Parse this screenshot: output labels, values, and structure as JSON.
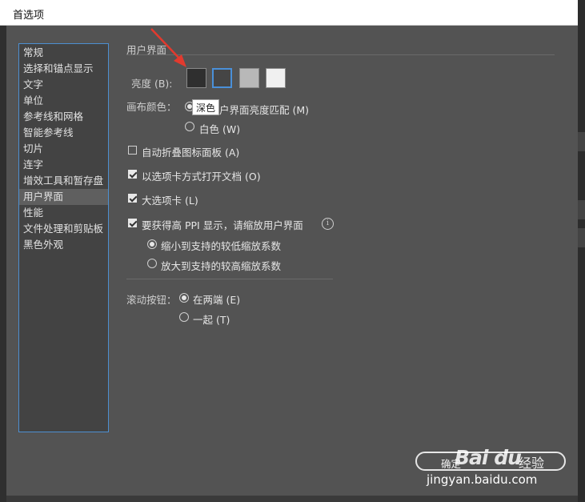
{
  "window": {
    "title": "首选项"
  },
  "sidebar": {
    "items": [
      {
        "label": "常规"
      },
      {
        "label": "选择和锚点显示"
      },
      {
        "label": "文字"
      },
      {
        "label": "单位"
      },
      {
        "label": "参考线和网格"
      },
      {
        "label": "智能参考线"
      },
      {
        "label": "切片"
      },
      {
        "label": "连字"
      },
      {
        "label": "增效工具和暂存盘"
      },
      {
        "label": "用户界面",
        "selected": true
      },
      {
        "label": "性能"
      },
      {
        "label": "文件处理和剪贴板"
      },
      {
        "label": "黑色外观"
      }
    ]
  },
  "panel": {
    "section_title": "用户界面",
    "brightness": {
      "label": "亮度 (B):",
      "swatches": [
        "#2f2f2f",
        "#535353",
        "#b8b8b8",
        "#f0f0f0"
      ],
      "selected_index": 1,
      "tooltip": "深色"
    },
    "canvas_color": {
      "label": "画布颜色：",
      "option_match": "户界面亮度匹配 (M)",
      "option_white": "白色 (W)"
    },
    "auto_collapse": "自动折叠图标面板 (A)",
    "open_tabs": "以选项卡方式打开文档 (O)",
    "large_tabs": "大选项卡 (L)",
    "hi_ppi": "要获得高 PPI 显示，请缩放用户界面",
    "scale_down": "缩小到支持的较低缩放系数",
    "scale_up": "放大到支持的较高缩放系数",
    "scroll": {
      "label": "滚动按钮：",
      "option_ends": "在两端 (E)",
      "option_together": "一起 (T)"
    }
  },
  "footer": {
    "ok_label": "确定"
  },
  "watermark": {
    "logo": "Bai du",
    "cn": "经验",
    "url": "jingyan.baidu.com"
  },
  "colors": {
    "dialog_bg": "#535353",
    "accent": "#4a90d9",
    "arrow": "#e23a2e"
  }
}
